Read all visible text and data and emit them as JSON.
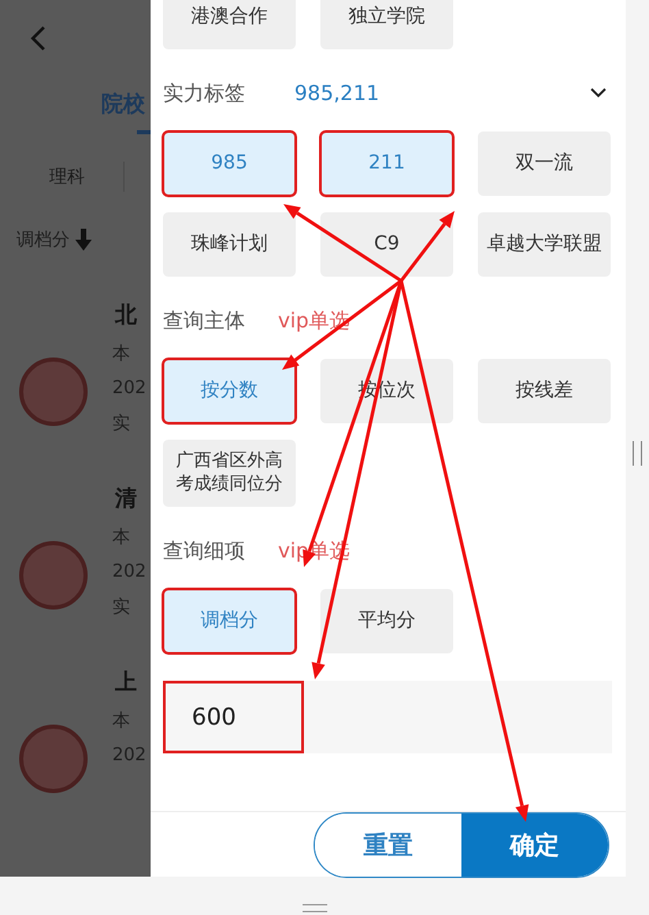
{
  "background_page": {
    "tab": "院校",
    "subject": "理科",
    "sort": "调档分",
    "schools": [
      {
        "name": "北",
        "lines": [
          "本",
          "202",
          "实"
        ]
      },
      {
        "name": "清",
        "lines": [
          "本",
          "202",
          "实"
        ]
      },
      {
        "name": "上",
        "lines": [
          "本",
          "202"
        ]
      }
    ]
  },
  "filter_panel": {
    "sections": [
      {
        "chips": [
          {
            "label": "港澳合作",
            "selected": false,
            "annotated": false
          },
          {
            "label": "独立学院",
            "selected": false,
            "annotated": false
          }
        ]
      },
      {
        "title": "实力标签",
        "value": "985,211",
        "chips": [
          {
            "label": "985",
            "selected": true,
            "annotated": true
          },
          {
            "label": "211",
            "selected": true,
            "annotated": true
          },
          {
            "label": "双一流",
            "selected": false,
            "annotated": false
          },
          {
            "label": "珠峰计划",
            "selected": false,
            "annotated": false
          },
          {
            "label": "C9",
            "selected": false,
            "annotated": false
          },
          {
            "label": "卓越大学联盟",
            "selected": false,
            "annotated": false
          }
        ]
      },
      {
        "title": "查询主体",
        "note": "vip单选",
        "chips": [
          {
            "label": "按分数",
            "selected": true,
            "annotated": true
          },
          {
            "label": "按位次",
            "selected": false,
            "annotated": false
          },
          {
            "label": "按线差",
            "selected": false,
            "annotated": false
          },
          {
            "label": "广西省区外高考成绩同位分",
            "selected": false,
            "annotated": false
          }
        ]
      },
      {
        "title": "查询细项",
        "note": "vip单选",
        "chips": [
          {
            "label": "调档分",
            "selected": true,
            "annotated": true
          },
          {
            "label": "平均分",
            "selected": false,
            "annotated": false
          }
        ]
      }
    ],
    "score_input": {
      "value": "600",
      "annotated": true
    },
    "buttons": [
      {
        "label": "重置",
        "kind": "secondary"
      },
      {
        "label": "确定",
        "kind": "primary"
      }
    ]
  }
}
